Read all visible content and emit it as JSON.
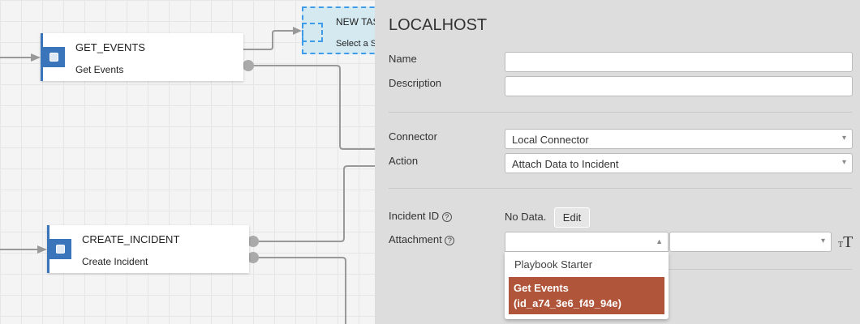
{
  "canvas": {
    "nodes": [
      {
        "title": "GET_EVENTS",
        "subtitle": "Get Events"
      },
      {
        "title": "CREATE_INCIDENT",
        "subtitle": "Create Incident"
      }
    ],
    "new_task": {
      "title": "NEW TASK",
      "subtitle": "Select a Step"
    }
  },
  "panel": {
    "title": "LOCALHOST",
    "name_label": "Name",
    "name_value": "",
    "description_label": "Description",
    "description_value": "",
    "connector_label": "Connector",
    "connector_value": "Local Connector",
    "action_label": "Action",
    "action_value": "Attach Data to Incident",
    "incident_id_label": "Incident ID",
    "incident_id_value": "No Data.",
    "edit_label": "Edit",
    "attachment_label": "Attachment",
    "attachment_options": [
      "Playbook Starter",
      "Get Events",
      "(id_a74_3e6_f49_94e)"
    ],
    "help_icon": "?"
  },
  "colors": {
    "accent": "#3a74bb",
    "highlight": "#b0553a"
  }
}
